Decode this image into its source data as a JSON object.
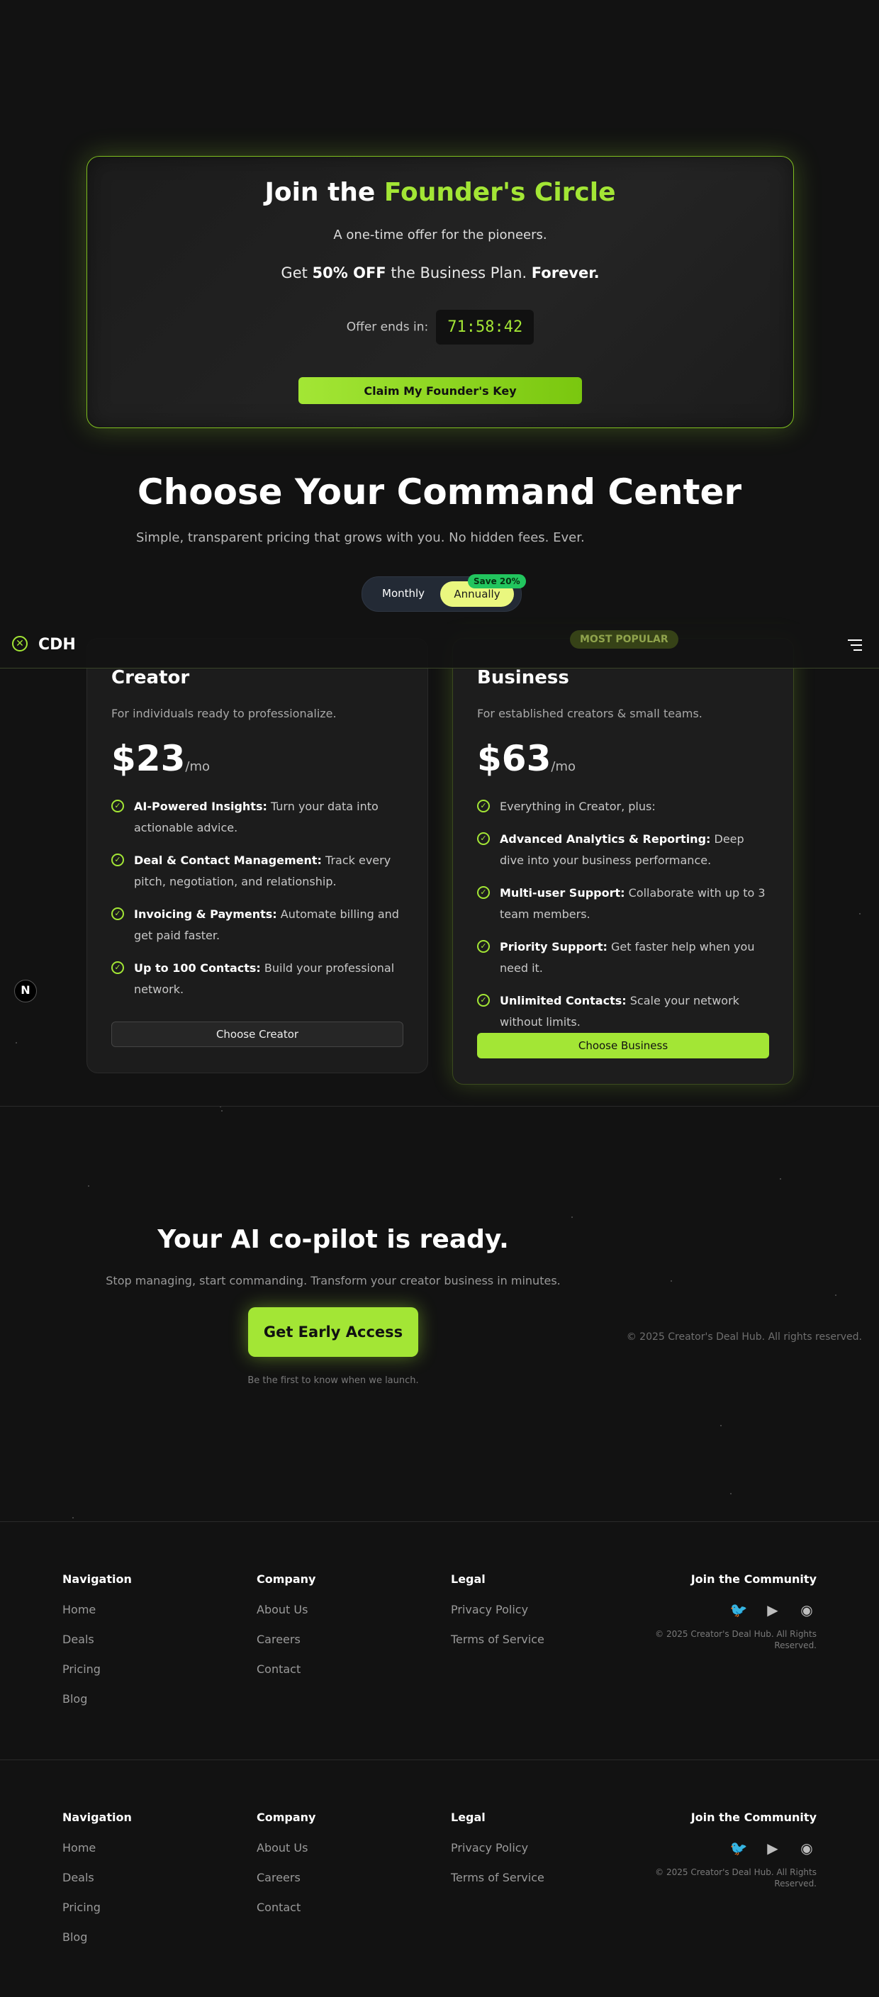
{
  "founder": {
    "title_prefix": "Join the ",
    "title_accent": "Founder's Circle",
    "tagline": "A one-time offer for the pioneers.",
    "offer_prefix": "Get ",
    "offer_bold": "50% OFF",
    "offer_mid": " the Business Plan. ",
    "offer_forever": "Forever.",
    "timer_label": "Offer ends in:",
    "timer_value": "71:58:42",
    "claim_label": "Claim My Founder's Key"
  },
  "pricing": {
    "title": "Choose Your Command Center",
    "subtitle": "Simple, transparent pricing that grows with you. No hidden fees. Ever.",
    "toggle_monthly": "Monthly",
    "toggle_annually": "Annually",
    "save_badge": "Save 20%",
    "popular_badge": "MOST POPULAR",
    "plans": [
      {
        "name": "Creator",
        "desc": "For individuals ready to professionalize.",
        "price": "$23",
        "per": "/mo",
        "features": [
          {
            "bold": "AI-Powered Insights:",
            "text": " Turn your data into actionable advice."
          },
          {
            "bold": "Deal & Contact Management:",
            "text": " Track every pitch, negotiation, and relationship."
          },
          {
            "bold": "Invoicing & Payments:",
            "text": " Automate billing and get paid faster."
          },
          {
            "bold": "Up to 100 Contacts:",
            "text": " Build your professional network."
          }
        ],
        "cta": "Choose Creator"
      },
      {
        "name": "Business",
        "desc": "For established creators & small teams.",
        "price": "$63",
        "per": "/mo",
        "features": [
          {
            "bold": "",
            "text": "Everything in Creator, plus:"
          },
          {
            "bold": "Advanced Analytics & Reporting:",
            "text": " Deep dive into your business performance."
          },
          {
            "bold": "Multi-user Support:",
            "text": " Collaborate with up to 3 team members."
          },
          {
            "bold": "Priority Support:",
            "text": " Get faster help when you need it."
          },
          {
            "bold": "Unlimited Contacts:",
            "text": " Scale your network without limits."
          }
        ],
        "cta": "Choose Business"
      }
    ]
  },
  "navbar": {
    "logo_glyph": "✕",
    "brand": "CDH"
  },
  "n_badge": "N",
  "cta": {
    "title": "Your AI co-pilot is ready.",
    "subtitle": "Stop managing, start commanding. Transform your creator business in minutes.",
    "button": "Get Early Access",
    "note": "Be the first to know when we launch.",
    "copyright": "© 2025 Creator's Deal Hub. All rights reserved."
  },
  "footer": {
    "nav_title": "Navigation",
    "nav_links": [
      "Home",
      "Deals",
      "Pricing",
      "Blog"
    ],
    "company_title": "Company",
    "company_links": [
      "About Us",
      "Careers",
      "Contact"
    ],
    "legal_title": "Legal",
    "legal_links": [
      "Privacy Policy",
      "Terms of Service"
    ],
    "community_title": "Join the Community",
    "icons": [
      "twitter-icon",
      "youtube-icon",
      "discord-icon"
    ],
    "copyright_line1": "© 2025 Creator's Deal Hub. All Rights",
    "copyright_line2": "Reserved."
  },
  "colors": {
    "accent": "#a3e635",
    "background": "#121212",
    "card": "#1c1c1c",
    "save_badge": "#22c55e"
  }
}
